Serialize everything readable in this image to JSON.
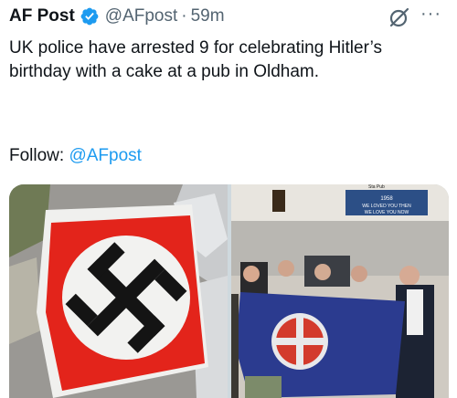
{
  "post": {
    "author_name": "AF Post",
    "handle": "@AFpost",
    "separator": "·",
    "time": "59m",
    "text": "UK police have arrested 9 for celebrating Hitler’s birthday with a cake at a pub in Oldham.",
    "follow_label": "Follow: ",
    "follow_mention": "@AFpost",
    "more_label": "···"
  },
  "icons": {
    "verified": "verified-badge-icon",
    "grok": "grok-icon",
    "more": "more-options-icon"
  },
  "media": {
    "right_banner_line1": "1958",
    "right_banner_line2": "WE LOVED YOU THEN",
    "right_banner_line3": "WE LOVE YOU NOW",
    "right_sign_text": "Sta Pub"
  },
  "colors": {
    "text": "#0f1419",
    "secondary": "#536471",
    "link": "#1d9bf0",
    "verified": "#1d9bf0"
  }
}
